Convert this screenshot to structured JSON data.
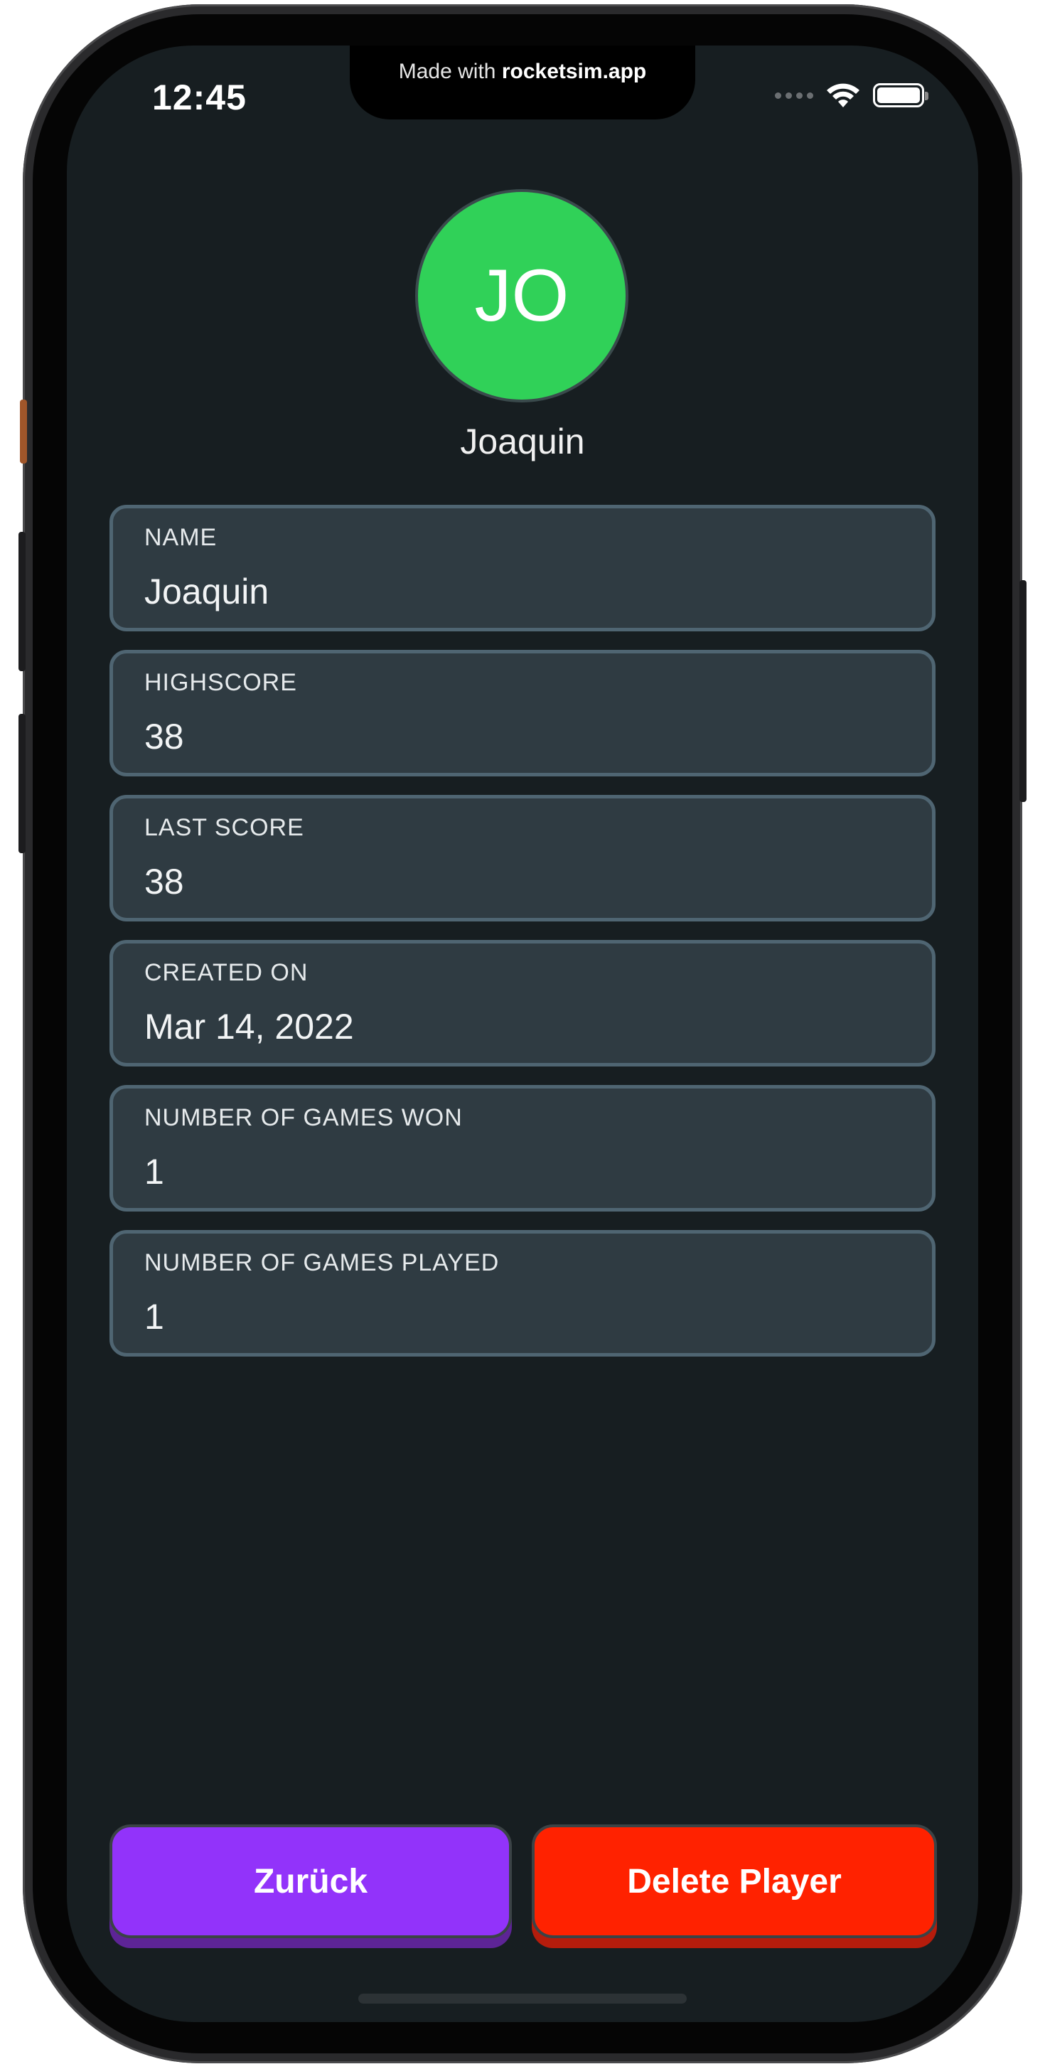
{
  "status_bar": {
    "time": "12:45",
    "notch_prefix": "Made with",
    "notch_brand": "rocketsim.app"
  },
  "profile": {
    "initials": "JO",
    "name": "Joaquin",
    "avatar_color": "#30d158"
  },
  "fields": [
    {
      "label": "NAME",
      "value": "Joaquin"
    },
    {
      "label": "HIGHSCORE",
      "value": "38"
    },
    {
      "label": "LAST SCORE",
      "value": "38"
    },
    {
      "label": "CREATED ON",
      "value": "Mar 14, 2022"
    },
    {
      "label": "NUMBER OF GAMES WON",
      "value": "1"
    },
    {
      "label": "NUMBER OF GAMES PLAYED",
      "value": "1"
    }
  ],
  "actions": {
    "back_label": "Zurück",
    "back_color": "#9233fa",
    "delete_label": "Delete Player",
    "delete_color": "#ff2200"
  },
  "icons": {
    "signal": "signal-dots-icon",
    "wifi": "wifi-icon",
    "battery": "battery-icon"
  }
}
